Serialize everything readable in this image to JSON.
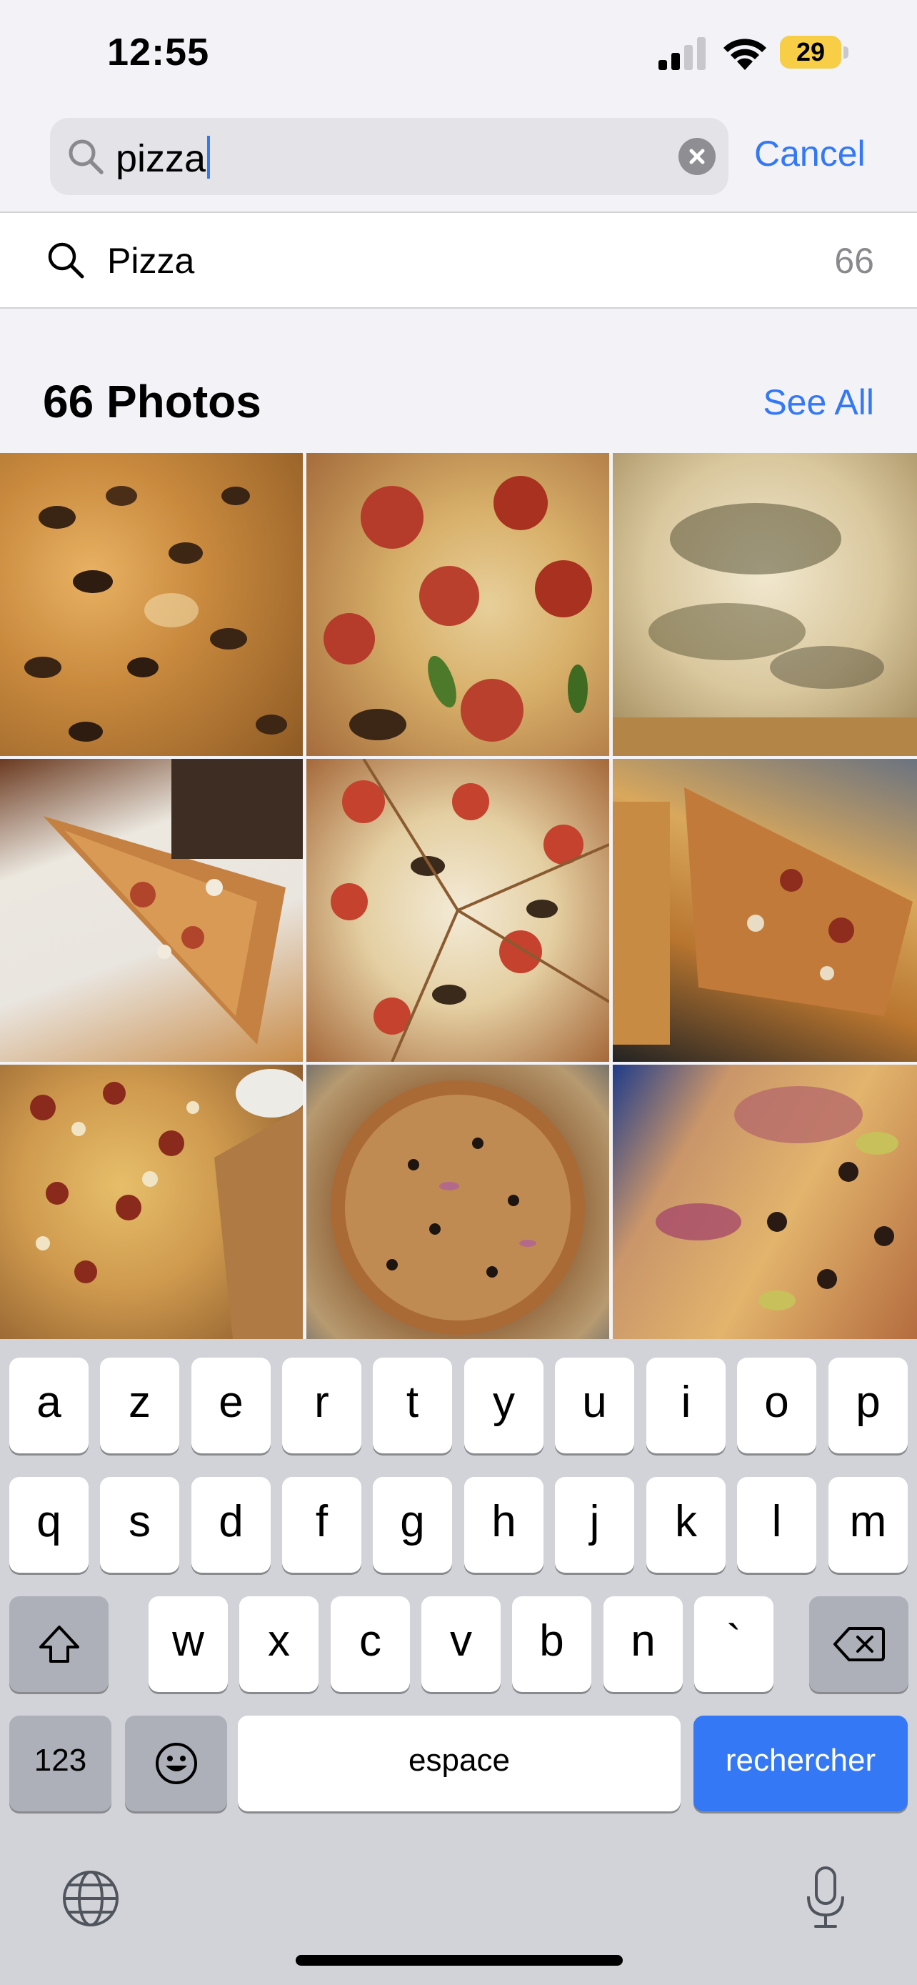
{
  "status_bar": {
    "time": "12:55",
    "battery_level": "29",
    "battery_fraction": 0.29,
    "battery_color": "#f7ce46"
  },
  "search": {
    "query": "pizza",
    "cancel_label": "Cancel",
    "accent": "#3478f6"
  },
  "suggestion": {
    "label": "Pizza",
    "count": "66"
  },
  "results": {
    "title": "66 Photos",
    "see_all_label": "See All"
  },
  "photos": [
    {
      "name": "photo-mushroom-pizza"
    },
    {
      "name": "photo-pepperoni-pepper-pizza"
    },
    {
      "name": "photo-herb-white-pizza"
    },
    {
      "name": "photo-pizza-slice-on-plate"
    },
    {
      "name": "photo-sliced-mushroom-pizza"
    },
    {
      "name": "photo-pizza-slices-on-pan"
    },
    {
      "name": "photo-sausage-corn-pizza"
    },
    {
      "name": "photo-supreme-pizza-in-box"
    },
    {
      "name": "photo-prosciutto-pizza"
    }
  ],
  "keyboard": {
    "row1": [
      "a",
      "z",
      "e",
      "r",
      "t",
      "y",
      "u",
      "i",
      "o",
      "p"
    ],
    "row2": [
      "q",
      "s",
      "d",
      "f",
      "g",
      "h",
      "j",
      "k",
      "l",
      "m"
    ],
    "row3": [
      "w",
      "x",
      "c",
      "v",
      "b",
      "n",
      "`"
    ],
    "numbers_label": "123",
    "space_label": "espace",
    "search_label": "rechercher",
    "icons": [
      "shift-icon",
      "backspace-icon",
      "emoji-icon",
      "globe-icon",
      "microphone-icon"
    ]
  }
}
